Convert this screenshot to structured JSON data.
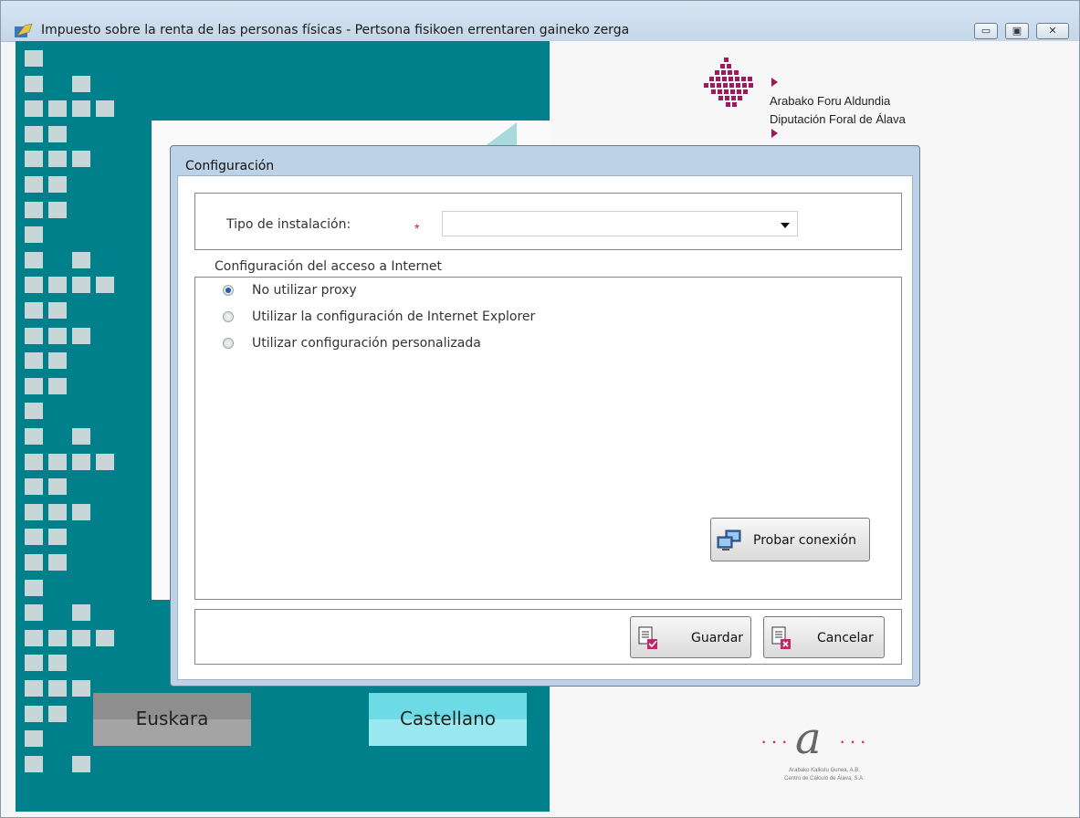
{
  "window": {
    "title": "Impuesto sobre la renta de las personas físicas -  Pertsona fisikoen errentaren gaineko zerga",
    "controls": {
      "minimize": "▭",
      "maximize": "▣",
      "close": "✕"
    }
  },
  "branding": {
    "diputacion_line1": "Arabako Foru Aldundia",
    "diputacion_line2": "Diputación Foral de Álava",
    "cca_line1": "Arabako Kalkulu Gunea, A.B.",
    "cca_line2": "Centro de Cálculo de Álava, S.A.",
    "accent_color": "#a0195e",
    "teal_color": "#00808a"
  },
  "languages": {
    "euskara": "Euskara",
    "castellano": "Castellano"
  },
  "dialog": {
    "title": "Configuración",
    "install_type_label": "Tipo de instalación:",
    "required_mark": "*",
    "install_type_value": "",
    "internet_section_label": "Configuración del acceso a Internet",
    "proxy_options": [
      {
        "label": "No utilizar proxy",
        "selected": true
      },
      {
        "label": "Utilizar la configuración de Internet Explorer",
        "selected": false
      },
      {
        "label": "Utilizar configuración personalizada",
        "selected": false
      }
    ],
    "test_connection_label": "Probar conexión",
    "save_label": "Guardar",
    "cancel_label": "Cancelar"
  }
}
